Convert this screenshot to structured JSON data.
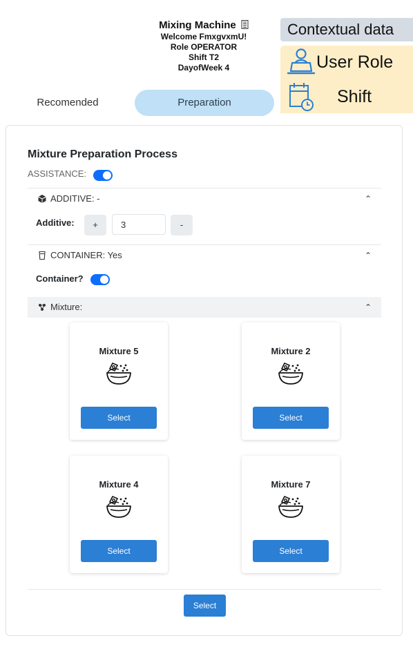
{
  "machine": {
    "title": "Mixing Machine",
    "welcome": "Welcome FmxgvxmU!",
    "role": "Role OPERATOR",
    "shift": "Shift T2",
    "day": "DayofWeek 4"
  },
  "context": {
    "label": "Contextual data",
    "user_role": "User Role",
    "shift": "Shift"
  },
  "tabs": {
    "recommended": "Recomended",
    "preparation": "Preparation"
  },
  "process": {
    "title": "Mixture Preparation Process",
    "assistance_label": "ASSISTANCE:",
    "assistance_on": true
  },
  "additive": {
    "header": "ADDITIVE: -",
    "field_label": "Additive:",
    "plus": "+",
    "minus": "-",
    "value": "3"
  },
  "container": {
    "header": "CONTAINER: Yes",
    "field_label": "Container?",
    "enabled": true
  },
  "mixture": {
    "header": "Mixture:",
    "cards": [
      {
        "name": "Mixture 5",
        "button": "Select"
      },
      {
        "name": "Mixture 2",
        "button": "Select"
      },
      {
        "name": "Mixture 4",
        "button": "Select"
      },
      {
        "name": "Mixture 7",
        "button": "Select"
      }
    ]
  },
  "footer": {
    "select_label": "Select"
  },
  "colors": {
    "primary_button": "#2b7fd4",
    "toggle": "#0d6efd",
    "active_tab": "#bfe0f6",
    "context_box": "#fdeec7",
    "context_label_bg": "#d5dbe3"
  }
}
